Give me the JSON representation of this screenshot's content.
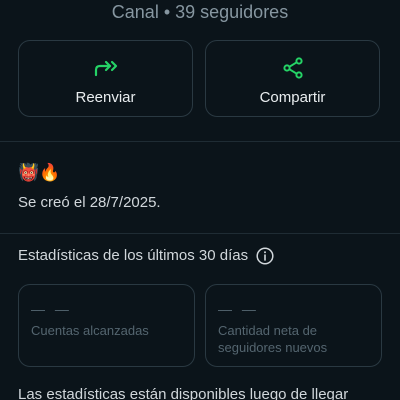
{
  "header": {
    "subtitle": "Canal • 39 seguidores"
  },
  "actions": {
    "forward_label": "Reenviar",
    "share_label": "Compartir",
    "accent_color": "#25d366"
  },
  "info": {
    "emojis": "👹🔥",
    "created_text": "Se creó el 28/7/2025."
  },
  "stats": {
    "title": "Estadísticas de los últimos 30 días",
    "cards": [
      {
        "value": "— —",
        "label": "Cuentas alcanzadas"
      },
      {
        "value": "— —",
        "label": "Cantidad neta de seguidores nuevos"
      }
    ]
  },
  "footer": {
    "text": "Las estadísticas están disponibles luego de llegar"
  }
}
